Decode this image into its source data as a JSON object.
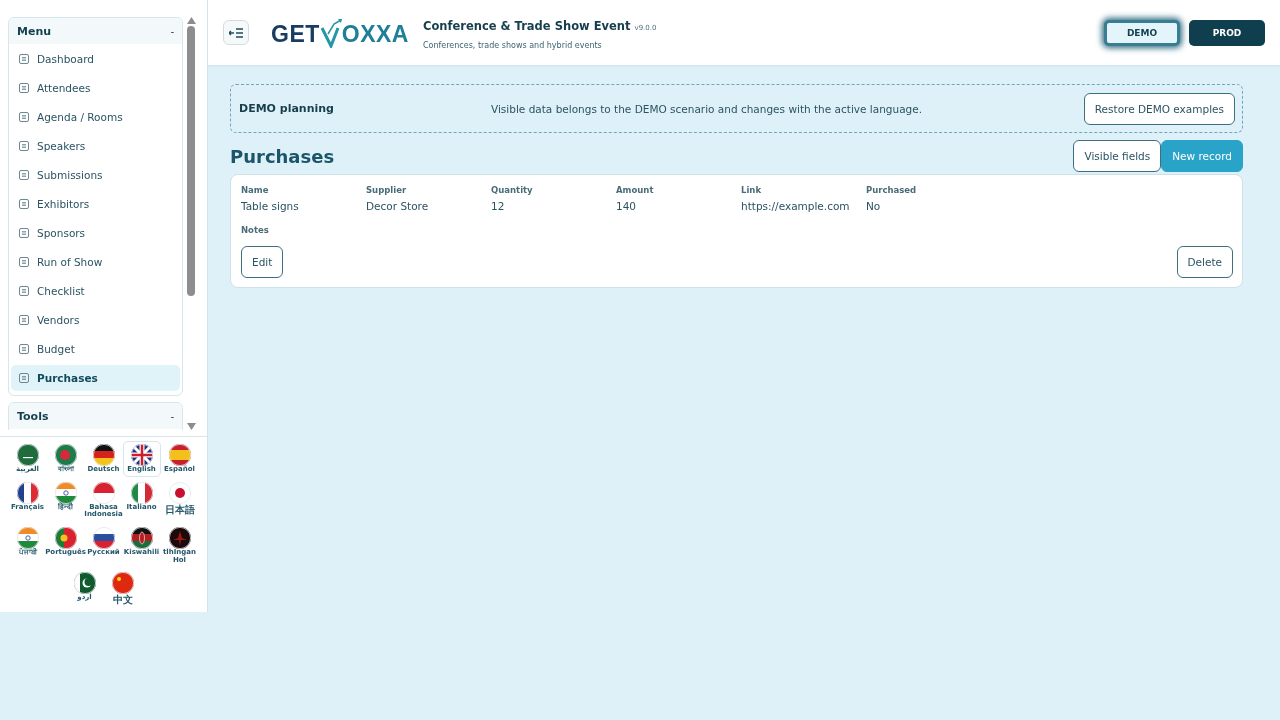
{
  "sidebar": {
    "menu": {
      "title": "Menu",
      "toggle": "-",
      "items": [
        {
          "label": "Dashboard",
          "selected": false
        },
        {
          "label": "Attendees",
          "selected": false
        },
        {
          "label": "Agenda / Rooms",
          "selected": false
        },
        {
          "label": "Speakers",
          "selected": false
        },
        {
          "label": "Submissions",
          "selected": false
        },
        {
          "label": "Exhibitors",
          "selected": false
        },
        {
          "label": "Sponsors",
          "selected": false
        },
        {
          "label": "Run of Show",
          "selected": false
        },
        {
          "label": "Checklist",
          "selected": false
        },
        {
          "label": "Vendors",
          "selected": false
        },
        {
          "label": "Budget",
          "selected": false
        },
        {
          "label": "Purchases",
          "selected": true
        }
      ]
    },
    "tools": {
      "title": "Tools",
      "toggle": "-"
    },
    "languages": [
      {
        "label": "العربية",
        "kind": "sa",
        "selected": false
      },
      {
        "label": "বাংলা",
        "kind": "bd",
        "selected": false
      },
      {
        "label": "Deutsch",
        "kind": "de",
        "selected": false
      },
      {
        "label": "English",
        "kind": "gb",
        "selected": true
      },
      {
        "label": "Español",
        "kind": "es",
        "selected": false
      },
      {
        "label": "Français",
        "kind": "fr",
        "selected": false
      },
      {
        "label": "हिन्दी",
        "kind": "in",
        "selected": false
      },
      {
        "label": "Bahasa Indonesia",
        "kind": "id",
        "selected": false
      },
      {
        "label": "Italiano",
        "kind": "it",
        "selected": false
      },
      {
        "label": "日本語",
        "kind": "jp",
        "selected": false
      },
      {
        "label": "ਪੰਜਾਬੀ",
        "kind": "in",
        "selected": false
      },
      {
        "label": "Português",
        "kind": "pt",
        "selected": false
      },
      {
        "label": "Русский",
        "kind": "ru",
        "selected": false
      },
      {
        "label": "Kiswahili",
        "kind": "ke",
        "selected": false
      },
      {
        "label": "tlhIngan Hol",
        "kind": "kl",
        "selected": false
      },
      {
        "label": "اردو",
        "kind": "pk",
        "selected": false
      },
      {
        "label": "中文",
        "kind": "cn",
        "selected": false
      }
    ]
  },
  "header": {
    "logo": {
      "left": "GET",
      "right": "OXXA"
    },
    "title": "Conference & Trade Show Event",
    "version": "v9.0.0",
    "subtitle": "Conferences, trade shows and hybrid events",
    "modes": [
      {
        "label": "DEMO",
        "selected": true
      },
      {
        "label": "PROD",
        "selected": false
      }
    ]
  },
  "notice": {
    "title": "DEMO planning",
    "text": "Visible data belongs to the DEMO scenario and changes with the active language.",
    "button": "Restore DEMO examples"
  },
  "page": {
    "title": "Purchases",
    "actions": [
      {
        "label": "Visible fields",
        "kind": "outline"
      },
      {
        "label": "New record",
        "kind": "primary"
      }
    ]
  },
  "record": {
    "fields": [
      {
        "label": "Name",
        "value": "Table signs"
      },
      {
        "label": "Supplier",
        "value": "Decor Store"
      },
      {
        "label": "Quantity",
        "value": "12"
      },
      {
        "label": "Amount",
        "value": "140"
      },
      {
        "label": "Link",
        "value": "https://example.com"
      },
      {
        "label": "Purchased",
        "value": "No"
      }
    ],
    "notes_label": "Notes",
    "edit": "Edit",
    "delete": "Delete"
  }
}
